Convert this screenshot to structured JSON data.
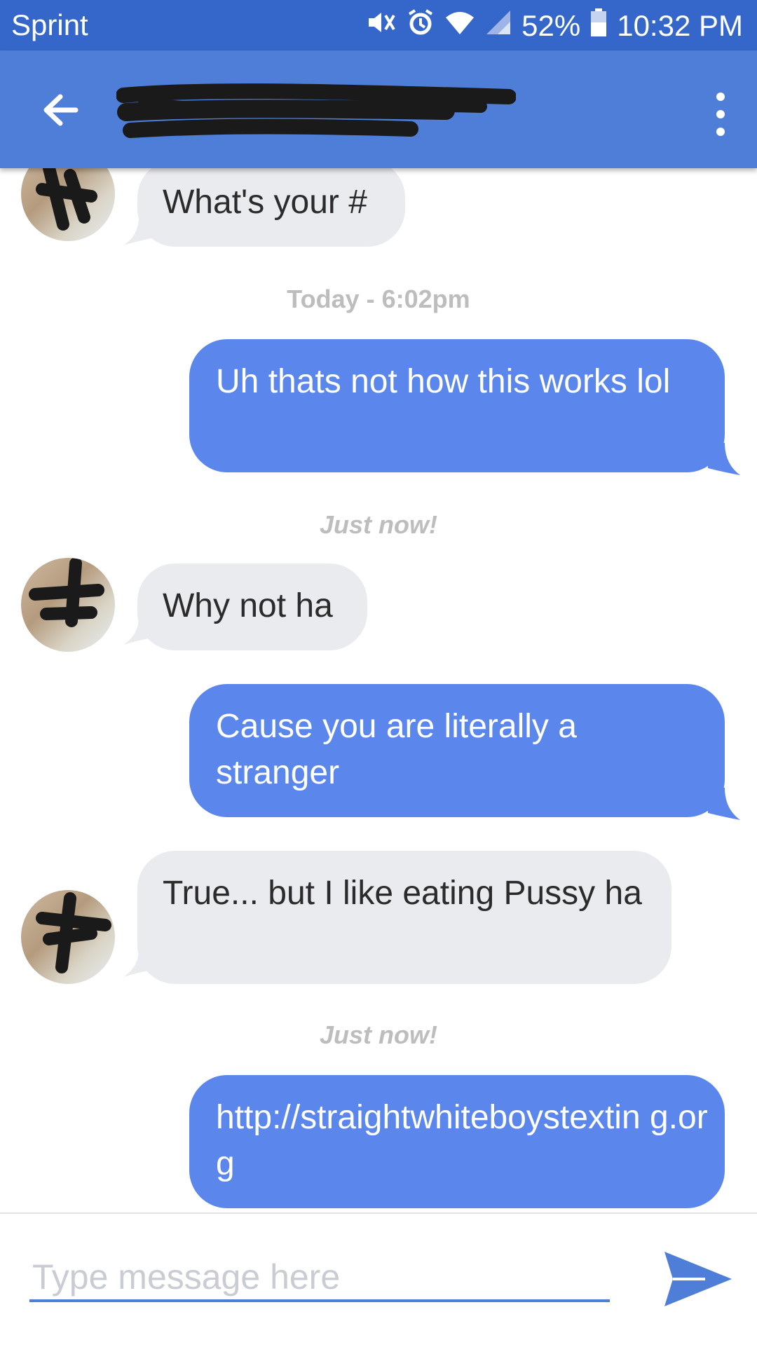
{
  "status_bar": {
    "carrier": "Sprint",
    "battery": "52%",
    "time": "10:32 PM",
    "icons": [
      "mute-icon",
      "alarm-icon",
      "wifi-icon",
      "signal-icon",
      "battery-icon"
    ]
  },
  "app_bar": {
    "title": "",
    "back_icon": "arrow-left-icon",
    "menu_icon": "more-vertical-icon"
  },
  "messages": [
    {
      "side": "in",
      "text": "What's your #"
    },
    {
      "side": "stamp",
      "text": "Today - 6:02pm"
    },
    {
      "side": "out",
      "text": "Uh thats not how this works lol"
    },
    {
      "side": "stamp",
      "text": "Just now!"
    },
    {
      "side": "in",
      "text": "Why not ha"
    },
    {
      "side": "out",
      "text": "Cause you are literally a stranger"
    },
    {
      "side": "in",
      "text": "True... but I like eating Pussy ha"
    },
    {
      "side": "stamp",
      "text": "Just now!"
    },
    {
      "side": "out",
      "text": "http://straightwhiteboystextin g.org"
    }
  ],
  "composer": {
    "placeholder": "Type message here",
    "value": "",
    "send_icon": "send-icon"
  },
  "colors": {
    "status_bar": "#3467c9",
    "app_bar": "#4f7ed8",
    "outgoing_bubble": "#5b87ec",
    "incoming_bubble": "#eaebef"
  }
}
